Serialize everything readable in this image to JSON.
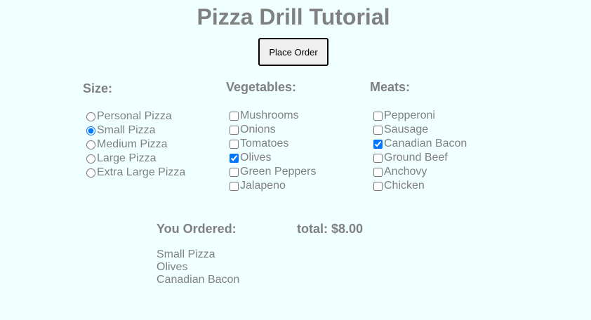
{
  "page": {
    "title": "Pizza Drill Tutorial",
    "place_order_label": "Place Order"
  },
  "size": {
    "heading": "Size:",
    "options": [
      {
        "label": "Personal Pizza",
        "checked": false
      },
      {
        "label": "Small Pizza",
        "checked": true
      },
      {
        "label": "Medium Pizza",
        "checked": false
      },
      {
        "label": "Large Pizza",
        "checked": false
      },
      {
        "label": "Extra Large Pizza",
        "checked": false
      }
    ]
  },
  "vegetables": {
    "heading": "Vegetables:",
    "options": [
      {
        "label": "Mushrooms",
        "checked": false
      },
      {
        "label": "Onions",
        "checked": false
      },
      {
        "label": "Tomatoes",
        "checked": false
      },
      {
        "label": "Olives",
        "checked": true
      },
      {
        "label": "Green Peppers",
        "checked": false
      },
      {
        "label": "Jalapeno",
        "checked": false
      }
    ]
  },
  "meats": {
    "heading": "Meats:",
    "options": [
      {
        "label": "Pepperoni",
        "checked": false
      },
      {
        "label": "Sausage",
        "checked": false
      },
      {
        "label": "Canadian Bacon",
        "checked": true
      },
      {
        "label": "Ground Beef",
        "checked": false
      },
      {
        "label": "Anchovy",
        "checked": false
      },
      {
        "label": "Chicken",
        "checked": false
      }
    ]
  },
  "summary": {
    "ordered_heading": "You Ordered:",
    "total_label": "total:",
    "total_value": "$8.00",
    "items": [
      "Small Pizza",
      "Olives",
      "Canadian Bacon"
    ]
  },
  "colors": {
    "background": "#f0ffff",
    "text": "#808080",
    "accent": "#0075ff"
  }
}
